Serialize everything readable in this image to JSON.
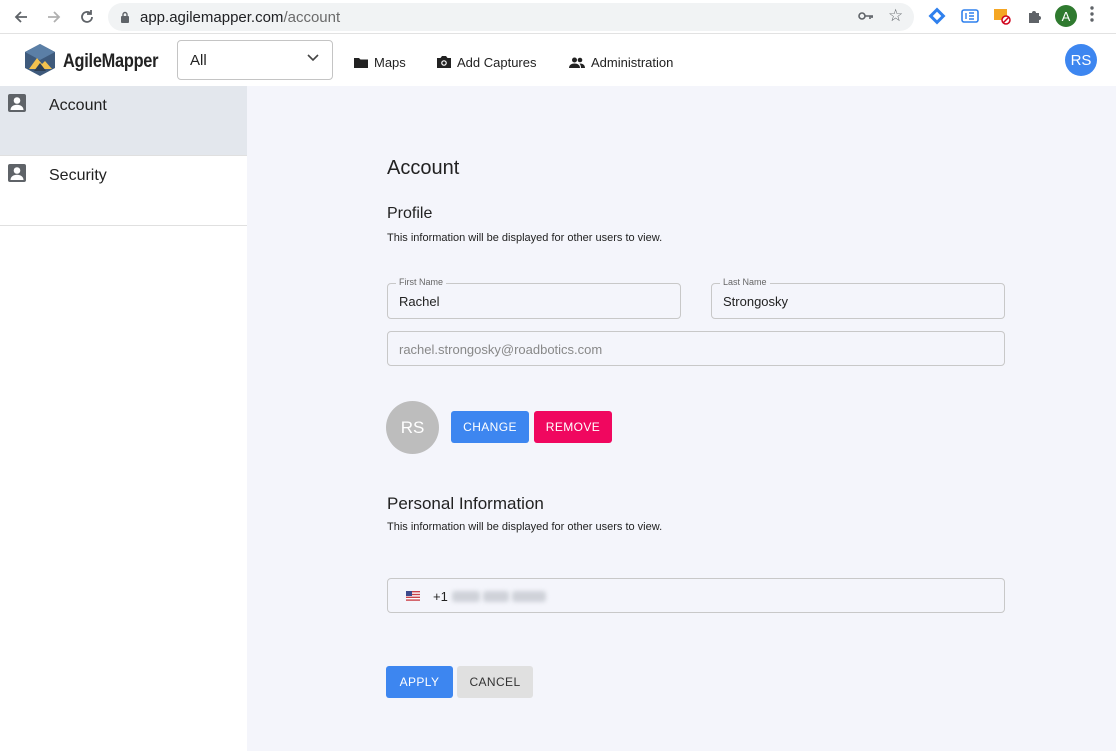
{
  "browser": {
    "url_host": "app.agilemapper.com",
    "url_path": "/account",
    "profile_initial": "A"
  },
  "header": {
    "brand": "AgileMapper",
    "selector_value": "All",
    "nav": {
      "maps": "Maps",
      "add_captures": "Add Captures",
      "administration": "Administration"
    },
    "avatar_initials": "RS"
  },
  "sidebar": {
    "items": [
      {
        "label": "Account",
        "active": true
      },
      {
        "label": "Security",
        "active": false
      }
    ]
  },
  "account": {
    "title": "Account",
    "profile_heading": "Profile",
    "profile_desc": "This information will be displayed for other users to view.",
    "first_name_label": "First Name",
    "first_name": "Rachel",
    "last_name_label": "Last Name",
    "last_name": "Strongosky",
    "email": "rachel.strongosky@roadbotics.com",
    "avatar_initials": "RS",
    "change_label": "CHANGE",
    "remove_label": "REMOVE",
    "personal_heading": "Personal Information",
    "personal_desc": "This information will be displayed for other users to view.",
    "phone_country_code": "+1",
    "apply_label": "APPLY",
    "cancel_label": "CANCEL"
  },
  "colors": {
    "primary": "#3d86f0",
    "danger": "#f0075f",
    "sidebar_active": "#e3e7ed",
    "content_bg": "#f4f5fb"
  }
}
